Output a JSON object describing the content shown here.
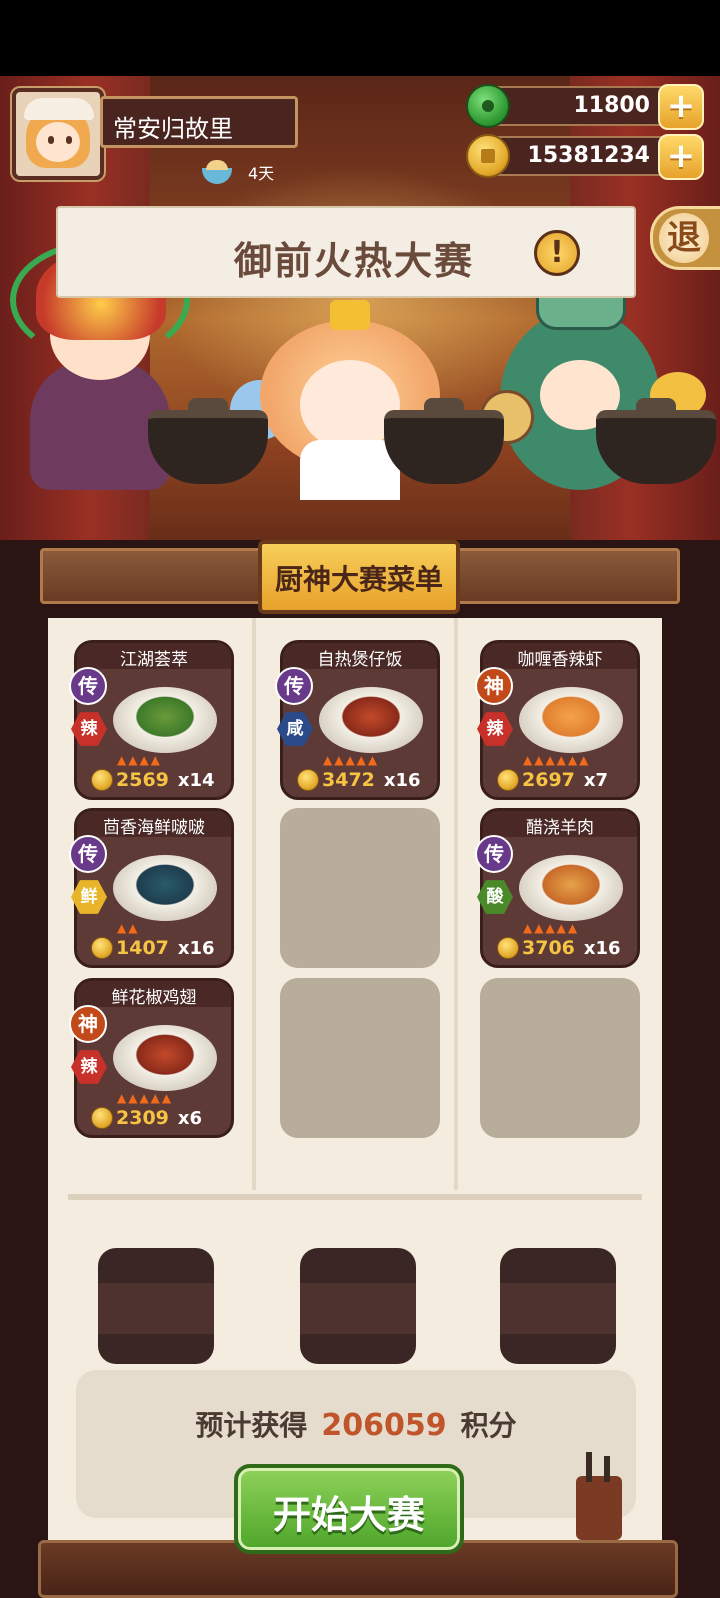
{
  "player": {
    "name": "常安归故里",
    "days": "4天"
  },
  "resources": {
    "jade": "11800",
    "coins": "15381234",
    "jade_plus": "+",
    "coins_plus": "+"
  },
  "exit_label": "退",
  "banner": {
    "title": "御前火热大赛",
    "alert": "!"
  },
  "menu": {
    "title": "厨神大赛菜单",
    "dishes": [
      {
        "name": "江湖荟萃",
        "grade": "传",
        "flavor": "辣",
        "price": "2569",
        "qty": "x14"
      },
      {
        "name": "自热煲仔饭",
        "grade": "传",
        "flavor": "咸",
        "price": "3472",
        "qty": "x16"
      },
      {
        "name": "咖喱香辣虾",
        "grade": "神",
        "flavor": "辣",
        "price": "2697",
        "qty": "x7"
      },
      {
        "name": "茴香海鲜啵啵",
        "grade": "传",
        "flavor": "鲜",
        "price": "1407",
        "qty": "x16"
      },
      {
        "name": "醋浇羊肉",
        "grade": "传",
        "flavor": "酸",
        "price": "3706",
        "qty": "x16"
      },
      {
        "name": "鲜花椒鸡翅",
        "grade": "神",
        "flavor": "辣",
        "price": "2309",
        "qty": "x6"
      }
    ]
  },
  "estimate": {
    "prefix": "预计获得",
    "value": "206059",
    "suffix": "积分"
  },
  "start_button": "开始大赛",
  "colors": {
    "accent": "#c0542a",
    "button_green": "#4ea52a",
    "panel": "#f4ecdf"
  }
}
